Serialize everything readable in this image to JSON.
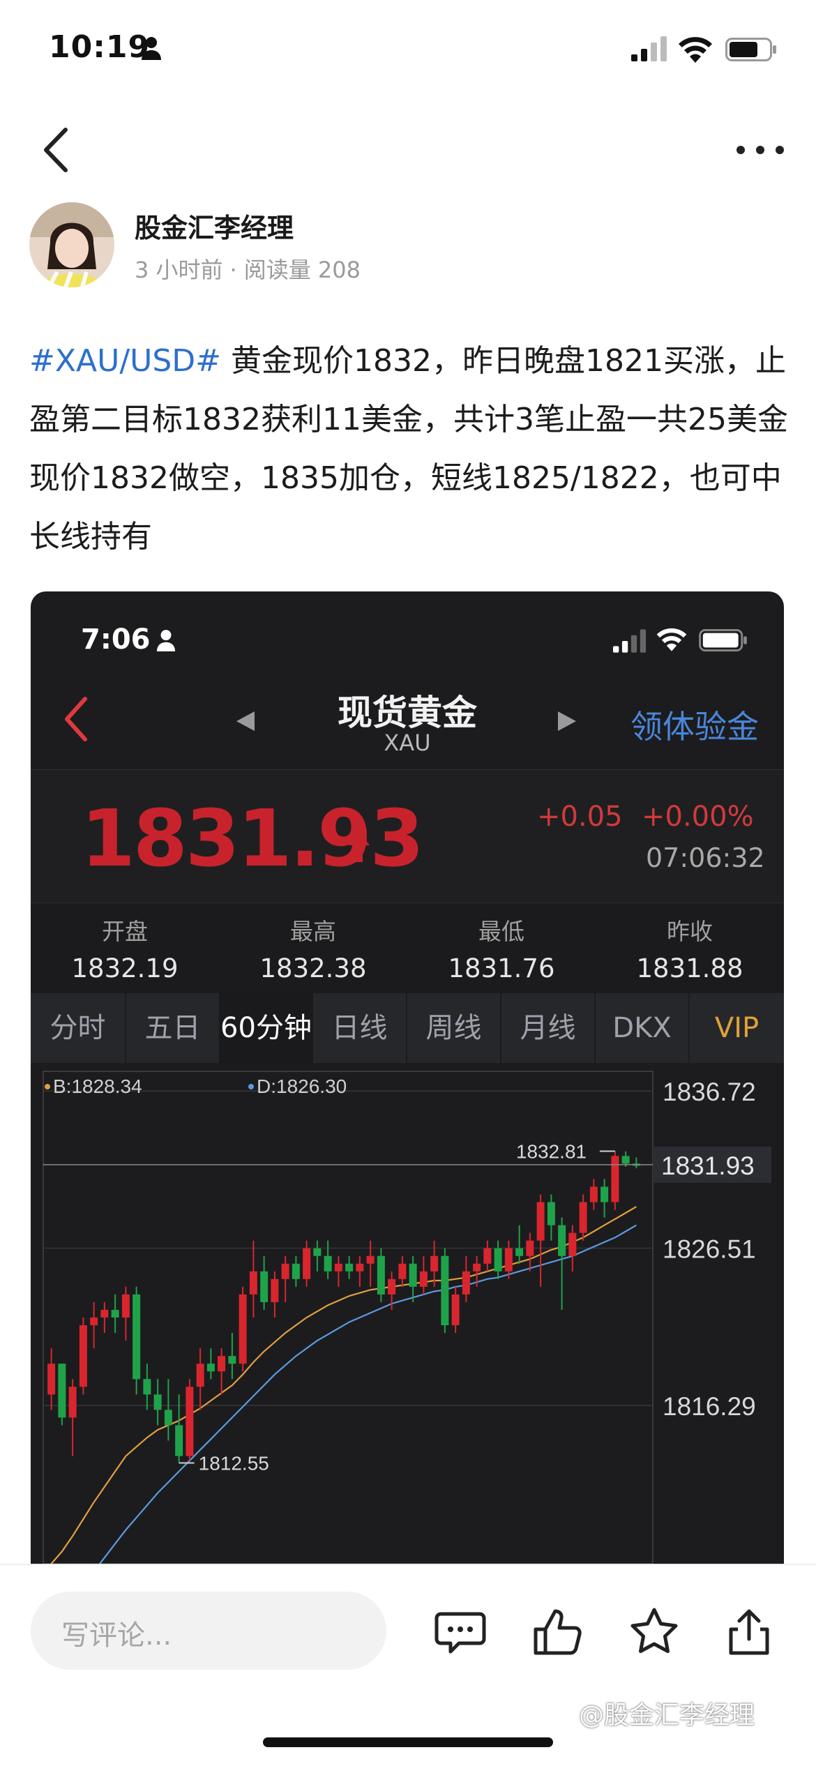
{
  "status_bar": {
    "time": "10:19"
  },
  "author": {
    "name": "股金汇李经理",
    "time_ago": "3 小时前",
    "separator": "·",
    "reads_label": "阅读量 208"
  },
  "post": {
    "hashtag": "#XAU/USD#",
    "body": " 黄金现价1832，昨日晚盘1821买涨，止盈第二目标1832获利11美金，共计3笔止盈一共25美金 现价1832做空，1835加仓，短线1825/1822，也可中长线持有"
  },
  "embedded": {
    "status_time": "7:06",
    "title": "现货黄金",
    "symbol": "XAU",
    "right_link": "领体验金",
    "price": "1831.93",
    "change": "+0.05",
    "change_pct": "+0.00%",
    "timestamp": "07:06:32",
    "ohlc": [
      {
        "label": "开盘",
        "value": "1832.19"
      },
      {
        "label": "最高",
        "value": "1832.38"
      },
      {
        "label": "最低",
        "value": "1831.76"
      },
      {
        "label": "昨收",
        "value": "1831.88"
      }
    ],
    "tabs": [
      "分时",
      "五日",
      "60分钟",
      "日线",
      "周线",
      "月线",
      "DKX",
      "VIP"
    ],
    "active_tab": "60分钟",
    "colors": {
      "up": "#d9262e",
      "down": "#1fa34a",
      "accent": "#4a86d9",
      "vip": "#e0a03a"
    }
  },
  "chart_data": {
    "type": "candlestick",
    "legend": [
      {
        "label": "B:1828.34",
        "color": "#e0a040"
      },
      {
        "label": "D:1826.30",
        "color": "#5b9be0"
      }
    ],
    "y_ticks": [
      "1836.72",
      "1826.51",
      "1816.29"
    ],
    "current_price_tag": "1831.93",
    "high_marker": "1832.81",
    "low_marker": "1812.55",
    "ylim": [
      1806,
      1838
    ],
    "candles": [
      [
        1817,
        1820,
        1816,
        1819
      ],
      [
        1819,
        1819,
        1815,
        1815.5
      ],
      [
        1815.5,
        1818,
        1813,
        1817.5
      ],
      [
        1817.5,
        1822,
        1817,
        1821.5
      ],
      [
        1821.5,
        1823,
        1820,
        1822
      ],
      [
        1822,
        1823,
        1821,
        1822.5
      ],
      [
        1822.5,
        1823.5,
        1821,
        1822
      ],
      [
        1822,
        1824,
        1820.5,
        1823.5
      ],
      [
        1823.5,
        1824,
        1817,
        1818
      ],
      [
        1818,
        1819,
        1816,
        1817
      ],
      [
        1817,
        1818,
        1815,
        1816
      ],
      [
        1816,
        1818,
        1814,
        1815
      ],
      [
        1815,
        1817,
        1812.55,
        1813
      ],
      [
        1813,
        1818,
        1812.7,
        1817.5
      ],
      [
        1817.5,
        1820,
        1816,
        1819
      ],
      [
        1819,
        1820,
        1818,
        1818.5
      ],
      [
        1818.5,
        1820,
        1817,
        1819.5
      ],
      [
        1819.5,
        1821,
        1818,
        1819
      ],
      [
        1819,
        1824,
        1818.5,
        1823.5
      ],
      [
        1823.5,
        1827,
        1822,
        1825
      ],
      [
        1825,
        1826,
        1822.5,
        1823
      ],
      [
        1823,
        1825,
        1822,
        1824.5
      ],
      [
        1824.5,
        1826,
        1823,
        1825.5
      ],
      [
        1825.5,
        1826,
        1824,
        1824.5
      ],
      [
        1824.5,
        1827,
        1824,
        1826.5
      ],
      [
        1826.5,
        1827,
        1825,
        1826
      ],
      [
        1826,
        1827,
        1824.5,
        1825
      ],
      [
        1825,
        1826,
        1824,
        1825.5
      ],
      [
        1825.5,
        1826,
        1824.5,
        1825
      ],
      [
        1825,
        1826,
        1824,
        1825.5
      ],
      [
        1825.5,
        1827,
        1824,
        1826
      ],
      [
        1826,
        1826.5,
        1823,
        1823.5
      ],
      [
        1823.5,
        1825,
        1822.5,
        1824.5
      ],
      [
        1824.5,
        1826,
        1824,
        1825.5
      ],
      [
        1825.5,
        1826,
        1823,
        1824
      ],
      [
        1824,
        1826,
        1823.5,
        1825
      ],
      [
        1825,
        1827,
        1824,
        1826
      ],
      [
        1826,
        1826.5,
        1821,
        1821.5
      ],
      [
        1821.5,
        1824,
        1821,
        1823.5
      ],
      [
        1823.5,
        1826,
        1823,
        1825
      ],
      [
        1825,
        1826,
        1824,
        1825.5
      ],
      [
        1825.5,
        1827,
        1825,
        1826.5
      ],
      [
        1826.5,
        1827,
        1824.5,
        1825
      ],
      [
        1825,
        1827,
        1824.5,
        1826.5
      ],
      [
        1826.5,
        1828,
        1825.5,
        1826
      ],
      [
        1826,
        1827.5,
        1825,
        1827
      ],
      [
        1827,
        1830,
        1824,
        1829.5
      ],
      [
        1829.5,
        1830,
        1827,
        1828
      ],
      [
        1828,
        1828.5,
        1822.5,
        1826
      ],
      [
        1826,
        1828,
        1825,
        1827.5
      ],
      [
        1827.5,
        1830,
        1827,
        1829.5
      ],
      [
        1829.5,
        1831,
        1829,
        1830.5
      ],
      [
        1830.5,
        1831,
        1828.5,
        1829.5
      ],
      [
        1829.5,
        1832.81,
        1829,
        1832.5
      ],
      [
        1832.5,
        1832.8,
        1831.8,
        1832
      ],
      [
        1832,
        1832.4,
        1831.7,
        1831.93
      ]
    ],
    "ma_b": [
      1806,
      1806.8,
      1807.8,
      1808.9,
      1810,
      1811,
      1812,
      1813,
      1813.6,
      1814.2,
      1814.7,
      1815,
      1815.3,
      1815.7,
      1816.1,
      1816.6,
      1817.1,
      1817.6,
      1818.3,
      1819.1,
      1819.8,
      1820.4,
      1821,
      1821.5,
      1822,
      1822.4,
      1822.8,
      1823.1,
      1823.4,
      1823.6,
      1823.8,
      1823.9,
      1824,
      1824.1,
      1824.2,
      1824.3,
      1824.4,
      1824.4,
      1824.5,
      1824.6,
      1824.8,
      1825,
      1825.2,
      1825.4,
      1825.6,
      1825.8,
      1826.1,
      1826.4,
      1826.6,
      1826.9,
      1827.2,
      1827.6,
      1828,
      1828.4,
      1828.8,
      1829.2
    ],
    "ma_d": [
      1802,
      1802.8,
      1803.7,
      1804.6,
      1805.5,
      1806.4,
      1807.3,
      1808.2,
      1809,
      1809.8,
      1810.6,
      1811.3,
      1812,
      1812.7,
      1813.4,
      1814.1,
      1814.8,
      1815.5,
      1816.2,
      1816.9,
      1817.6,
      1818.3,
      1818.9,
      1819.5,
      1820,
      1820.5,
      1820.9,
      1821.3,
      1821.7,
      1822,
      1822.3,
      1822.6,
      1822.9,
      1823.1,
      1823.3,
      1823.5,
      1823.7,
      1823.8,
      1824,
      1824.1,
      1824.3,
      1824.5,
      1824.6,
      1824.8,
      1825,
      1825.2,
      1825.4,
      1825.6,
      1825.8,
      1826,
      1826.3,
      1826.6,
      1826.9,
      1827.2,
      1827.6,
      1828
    ]
  },
  "bottom": {
    "comment_placeholder": "写评论...",
    "watermark": "@股金汇李经理"
  }
}
